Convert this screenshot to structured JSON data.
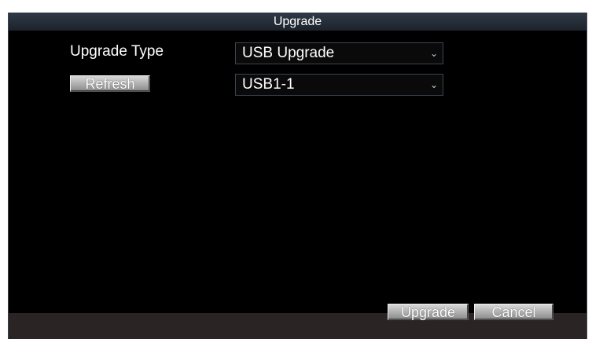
{
  "dialog": {
    "title": "Upgrade"
  },
  "form": {
    "upgrade_type_label": "Upgrade Type",
    "upgrade_type_value": "USB Upgrade",
    "refresh_label": "Refresh",
    "device_value": "USB1-1"
  },
  "footer": {
    "upgrade_label": "Upgrade",
    "cancel_label": "Cancel"
  },
  "icons": {
    "dropdown": "chevron-down-icon"
  }
}
